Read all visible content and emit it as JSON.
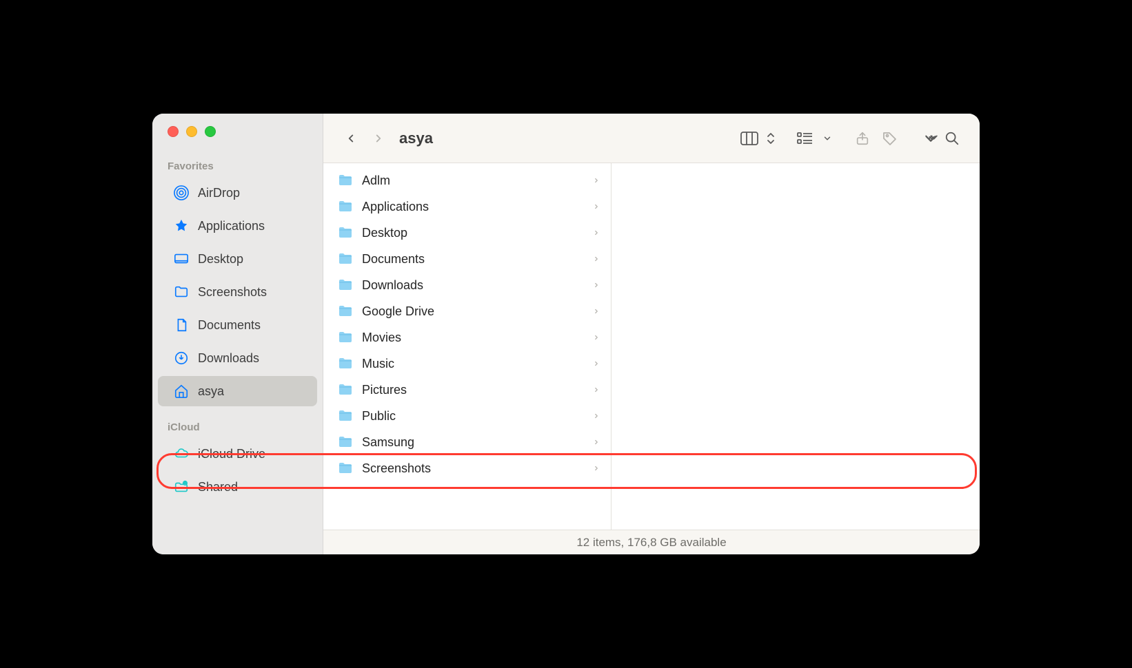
{
  "window_title": "asya",
  "sidebar": {
    "sections": [
      {
        "label": "Favorites",
        "items": [
          {
            "icon": "airdrop-icon",
            "label": "AirDrop",
            "selected": false
          },
          {
            "icon": "apps-icon",
            "label": "Applications",
            "selected": false
          },
          {
            "icon": "desktop-icon",
            "label": "Desktop",
            "selected": false
          },
          {
            "icon": "folder-icon",
            "label": "Screenshots",
            "selected": false
          },
          {
            "icon": "document-icon",
            "label": "Documents",
            "selected": false
          },
          {
            "icon": "downloads-icon",
            "label": "Downloads",
            "selected": false
          },
          {
            "icon": "home-icon",
            "label": "asya",
            "selected": true
          }
        ]
      },
      {
        "label": "iCloud",
        "items": [
          {
            "icon": "cloud-icon",
            "label": "iCloud Drive",
            "selected": false
          },
          {
            "icon": "shared-icon",
            "label": "Shared",
            "selected": false
          }
        ]
      }
    ]
  },
  "folders": [
    {
      "name": "Adlm"
    },
    {
      "name": "Applications"
    },
    {
      "name": "Desktop"
    },
    {
      "name": "Documents"
    },
    {
      "name": "Downloads"
    },
    {
      "name": "Google Drive"
    },
    {
      "name": "Movies"
    },
    {
      "name": "Music"
    },
    {
      "name": "Pictures"
    },
    {
      "name": "Public"
    },
    {
      "name": "Samsung"
    },
    {
      "name": "Screenshots"
    }
  ],
  "statusbar": "12 items, 176,8 GB available"
}
